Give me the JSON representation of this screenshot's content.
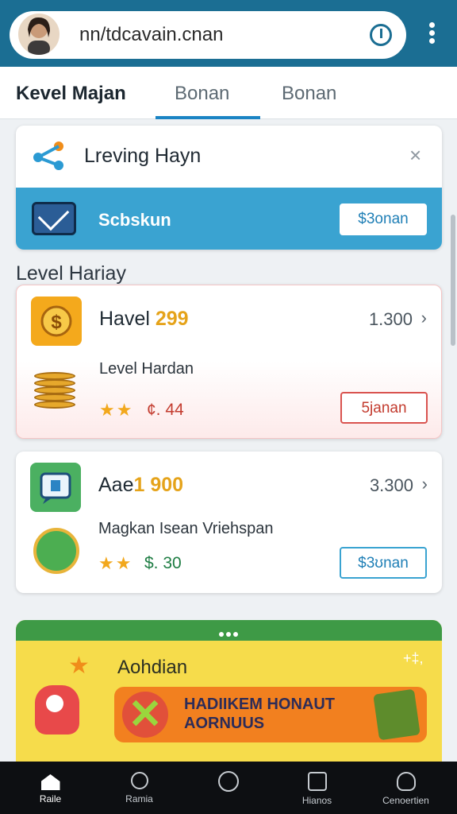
{
  "browser": {
    "url": "nn/tdcavain.cnan",
    "reload_icon": "reload-icon",
    "menu_icon": "kebab-menu-icon"
  },
  "tabs": [
    {
      "label": "Kevel Majan",
      "active": true
    },
    {
      "label": "Bonan",
      "active": false
    },
    {
      "label": "Bonan",
      "active": false
    }
  ],
  "header_card": {
    "title": "Lreving Hayn",
    "close_icon": "close-icon",
    "band_label": "Scbskun",
    "band_button": "$3onan"
  },
  "section_heading": "Level Hariay",
  "list_items": [
    {
      "title": "Havel",
      "highlight": "299",
      "value": "1.300",
      "subtitle": "Level Hardan",
      "rating": "★★",
      "price": "¢. 44",
      "button": "5janan",
      "price_color": "#c33b2e",
      "button_color": "#c33b2e"
    },
    {
      "title": "Aae",
      "highlight": "1 900",
      "value": "3.300",
      "subtitle": "Magkan Isean Vriehspan",
      "rating": "★★",
      "price": "$. 30",
      "button": "$3ʊnan",
      "price_color": "#1e7d43",
      "button_color": "#1f7fb6"
    }
  ],
  "banner": {
    "title": "Aohdian",
    "promo_text": "HADIIKEM HONAUT AORNUUS",
    "deco": "+‡,"
  },
  "bottom_nav": [
    {
      "label": "Raile",
      "icon": "home-icon",
      "active": true
    },
    {
      "label": "Ramia",
      "icon": "search-icon",
      "active": false
    },
    {
      "label": "",
      "icon": "circle-icon",
      "active": false
    },
    {
      "label": "Hianos",
      "icon": "square-icon",
      "active": false
    },
    {
      "label": "Cenoertien",
      "icon": "profile-icon",
      "active": false
    }
  ]
}
